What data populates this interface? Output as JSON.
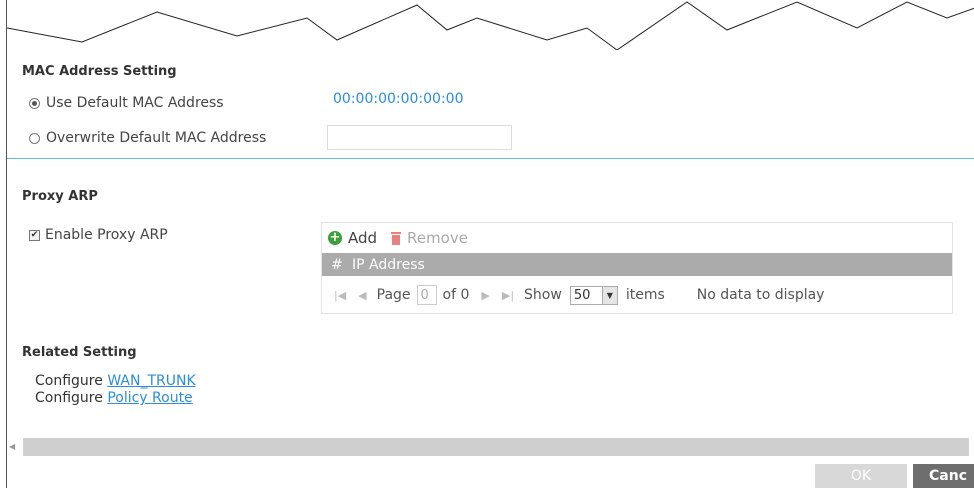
{
  "mac_section": {
    "title": "MAC Address Setting",
    "use_default_label": "Use Default MAC Address",
    "default_mac": "00:00:00:00:00:00",
    "overwrite_label": "Overwrite Default MAC Address",
    "overwrite_value": ""
  },
  "proxy_arp": {
    "title": "Proxy ARP",
    "enable_label": "Enable Proxy ARP",
    "enabled": true,
    "toolbar": {
      "add_label": "Add",
      "remove_label": "Remove"
    },
    "columns": [
      "#",
      "IP Address"
    ],
    "pager": {
      "page_label": "Page",
      "page_value": "0",
      "of_label": "of 0",
      "show_label": "Show",
      "show_value": "50",
      "items_label": "items",
      "empty_label": "No data to display"
    }
  },
  "related": {
    "title": "Related Setting",
    "items": [
      {
        "prefix": "Configure",
        "link": "WAN_TRUNK"
      },
      {
        "prefix": "Configure",
        "link": "Policy Route"
      }
    ]
  },
  "footer": {
    "ok_label": "OK",
    "cancel_label": "Canc"
  }
}
